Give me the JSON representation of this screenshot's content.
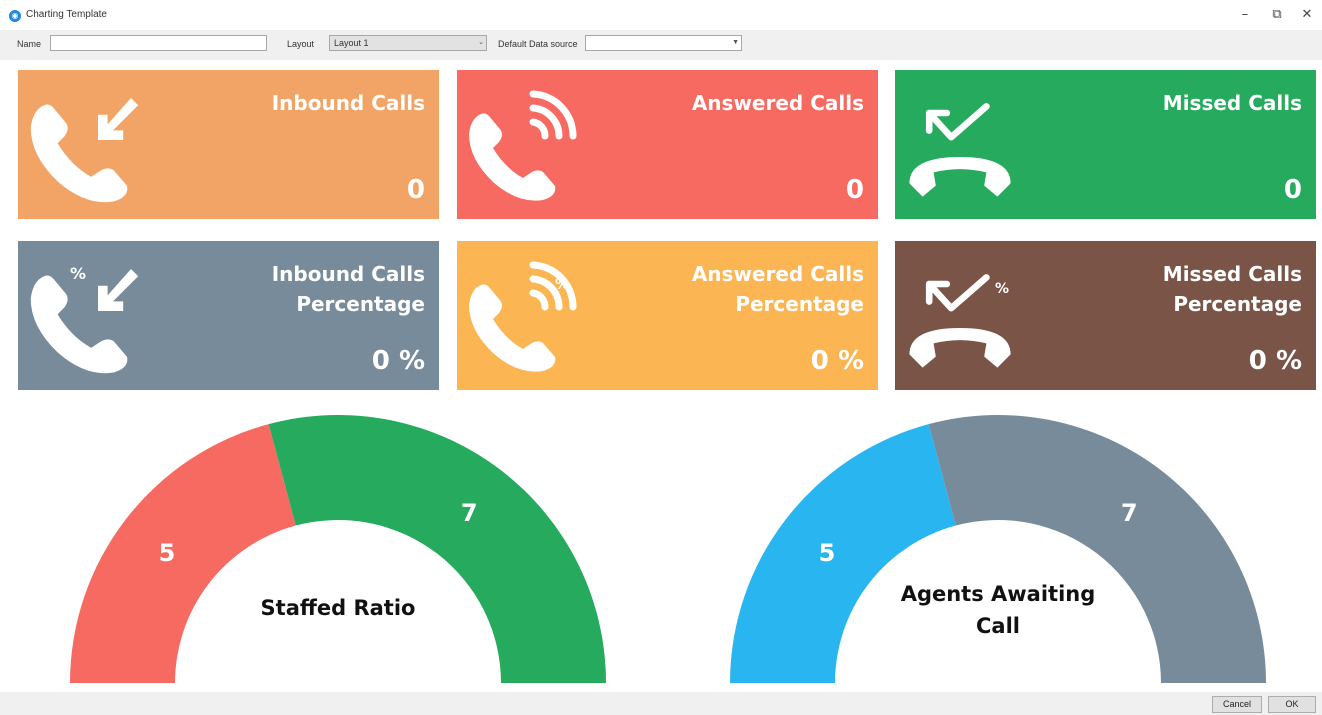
{
  "window": {
    "title": "Charting Template",
    "minimize_glyph": "–",
    "restore_glyph": "⧉",
    "close_glyph": "✕"
  },
  "toolbar": {
    "name_label": "Name",
    "name_value": "",
    "layout_label": "Layout",
    "layout_value": "Layout 1",
    "datasource_label": "Default Data source",
    "datasource_value": ""
  },
  "cards": [
    {
      "title": "Inbound Calls",
      "value": "0",
      "color": "#f2a466",
      "icon": "inbound-call-icon"
    },
    {
      "title": "Answered Calls",
      "value": "0",
      "color": "#f66a62",
      "icon": "answered-call-icon"
    },
    {
      "title": "Missed Calls",
      "value": "0",
      "color": "#26aa5e",
      "icon": "missed-call-icon"
    },
    {
      "title": "Inbound Calls Percentage",
      "value": "0 %",
      "color": "#788b9a",
      "icon": "inbound-call-percentage-icon"
    },
    {
      "title": "Answered Calls Percentage",
      "value": "0 %",
      "color": "#fbb553",
      "icon": "answered-call-percentage-icon"
    },
    {
      "title": "Missed Calls Percentage",
      "value": "0 %",
      "color": "#7a5447",
      "icon": "missed-call-percentage-icon"
    }
  ],
  "gauges": [
    {
      "label": "Staffed Ratio",
      "segments": [
        {
          "value": 5,
          "color": "#f66a62"
        },
        {
          "value": 7,
          "color": "#26aa5e"
        }
      ]
    },
    {
      "label": "Agents Awaiting Call",
      "segments": [
        {
          "value": 5,
          "color": "#29b6f0"
        },
        {
          "value": 7,
          "color": "#788b9a"
        }
      ]
    }
  ],
  "footer": {
    "cancel_label": "Cancel",
    "ok_label": "OK"
  }
}
